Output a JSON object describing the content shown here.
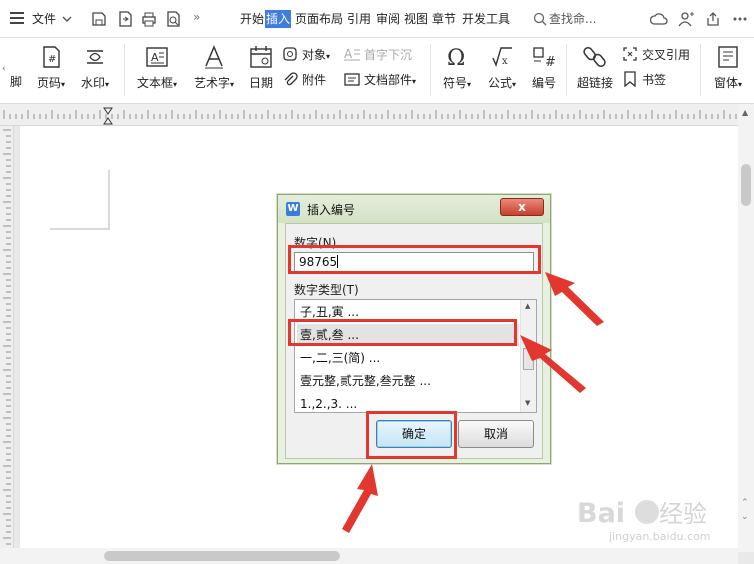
{
  "topbar": {
    "file_menu": "文件",
    "tabs": [
      "开始",
      "插入",
      "页面布局",
      "引用",
      "审阅",
      "视图",
      "章节",
      "开发工具"
    ],
    "active_tab": "插入",
    "search_placeholder": "查找命..."
  },
  "ribbon": {
    "page_header_fragment": "脚",
    "page_number": "页码",
    "watermark": "水印",
    "textbox": "文本框",
    "wordart": "艺术字",
    "date": "日期",
    "object": "对象",
    "attachment": "附件",
    "drop_cap": "首字下沉",
    "doc_parts": "文档部件",
    "symbol": "符号",
    "formula": "公式",
    "numbering": "编号",
    "hyperlink": "超链接",
    "cross_reference": "交叉引用",
    "bookmark": "书签",
    "window": "窗体"
  },
  "dialog": {
    "title": "插入编号",
    "number_label": "数字(N)",
    "number_value": "98765",
    "type_label": "数字类型(T)",
    "types": [
      "子,丑,寅 ...",
      "壹,贰,叁 ...",
      "一,二,三(简) ...",
      "壹元整,贰元整,叁元整 ...",
      "1.,2.,3. ..."
    ],
    "selected_type": "壹,贰,叁 ...",
    "ok_label": "确定",
    "cancel_label": "取消",
    "close_label": "x"
  },
  "watermark_text": {
    "brand": "Baidu经验",
    "url": "jingyan.baidu.com"
  },
  "colors": {
    "accent": "#3f7de0",
    "annotation_red": "#e2372f",
    "dialog_frame": "#e8f0df"
  }
}
